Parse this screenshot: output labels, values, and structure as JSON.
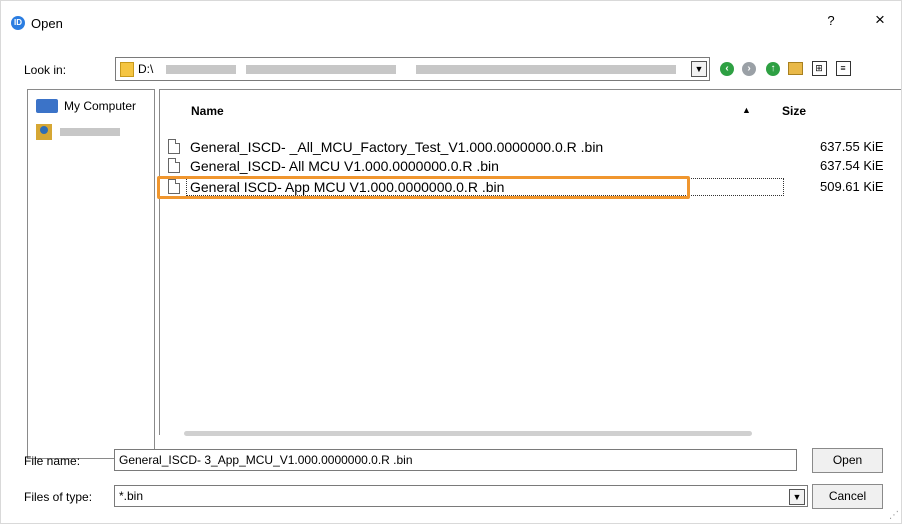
{
  "window": {
    "title": "Open",
    "help": "?",
    "close": "×"
  },
  "lookin": {
    "label": "Look in:",
    "path": "D:\\"
  },
  "toolbar": {
    "back_icon": "arrow-left-circle-icon",
    "forward_icon": "arrow-right-circle-icon",
    "up_icon": "arrow-up-circle-icon",
    "new_folder_icon": "new-folder-icon",
    "list_view_icon": "list-view-icon",
    "detail_view_icon": "detail-view-icon"
  },
  "sidebar": {
    "items": [
      {
        "label": "My Computer"
      },
      {
        "label": ""
      }
    ]
  },
  "filelist": {
    "columns": {
      "name": "Name",
      "size": "Size"
    },
    "files": [
      {
        "name": "General_ISCD-    _All_MCU_Factory_Test_V1.000.0000000.0.R            .bin",
        "size": "637.55 KiE"
      },
      {
        "name": "General_ISCD-      All  MCU  V1.000.0000000.0.R            .bin",
        "size": "637.54 KiE"
      },
      {
        "name": "General  ISCD-       App  MCU  V1.000.0000000.0.R            .bin",
        "size": "509.61 KiE"
      }
    ],
    "selected_index": 2
  },
  "filename": {
    "label": "File name:",
    "value": "General_ISCD-  3_App_MCU_V1.000.0000000.0.R          .bin"
  },
  "filetype": {
    "label": "Files of type:",
    "value": "*.bin"
  },
  "buttons": {
    "open": "Open",
    "cancel": "Cancel"
  },
  "colors": {
    "highlight": "#f0962e",
    "accent": "#2a7de1"
  }
}
